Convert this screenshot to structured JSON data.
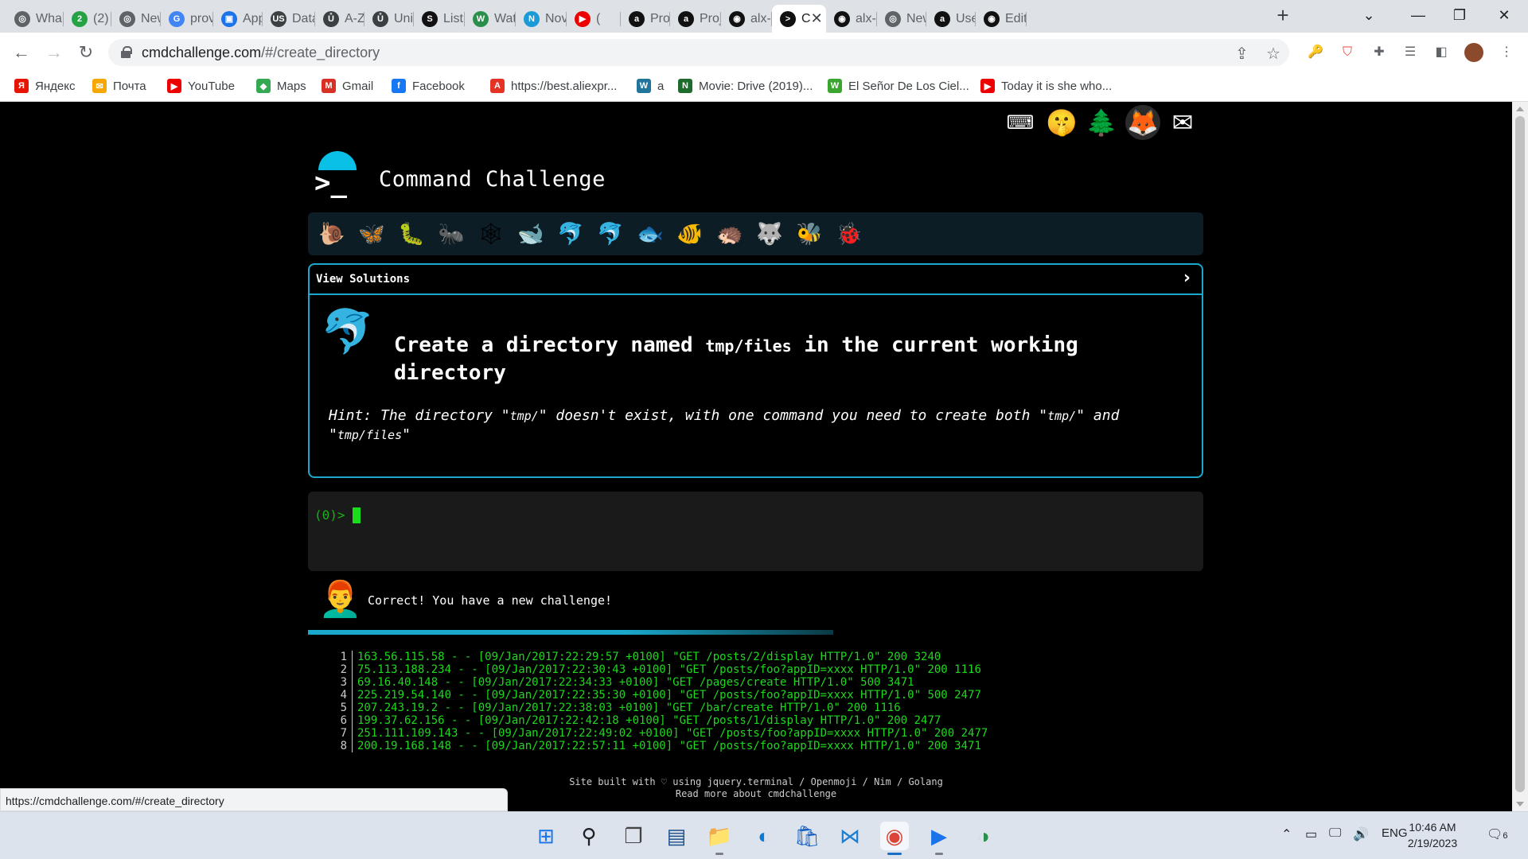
{
  "browser": {
    "tabs": [
      {
        "label": "Wha",
        "icon": "whatsapp-icon",
        "color": "#5f6368",
        "glyph": "◎"
      },
      {
        "label": "(2) V",
        "icon": "whatsapp-2-icon",
        "color": "#25a244",
        "glyph": "2"
      },
      {
        "label": "New",
        "icon": "chrome-icon",
        "color": "#5f6368",
        "glyph": "◎"
      },
      {
        "label": "prov",
        "icon": "google-icon",
        "color": "#4285f4",
        "glyph": "G"
      },
      {
        "label": "App",
        "icon": "app-icon",
        "color": "#1a73e8",
        "glyph": "▣"
      },
      {
        "label": "Data",
        "icon": "data-icon",
        "color": "#3c4043",
        "glyph": "US"
      },
      {
        "label": "A-Z",
        "icon": "az-icon",
        "color": "#3c4043",
        "glyph": "Ů"
      },
      {
        "label": "Univ",
        "icon": "univ-icon",
        "color": "#3c4043",
        "glyph": "Ů"
      },
      {
        "label": "List",
        "icon": "list-icon",
        "color": "#111",
        "glyph": "S"
      },
      {
        "label": "Wat",
        "icon": "wat-icon",
        "color": "#2a8f4a",
        "glyph": "W"
      },
      {
        "label": "Nov",
        "icon": "nov-icon",
        "color": "#1a9ad6",
        "glyph": "N"
      },
      {
        "label": "(",
        "icon": "youtube-icon",
        "color": "#e00",
        "glyph": "▶"
      },
      {
        "label": "Proj",
        "icon": "alx-icon",
        "color": "#111",
        "glyph": "a"
      },
      {
        "label": "Proj",
        "icon": "alx-icon",
        "color": "#111",
        "glyph": "a"
      },
      {
        "label": "alx-s",
        "icon": "github-icon",
        "color": "#111",
        "glyph": "◉"
      },
      {
        "label": "C",
        "icon": "terminal-icon",
        "color": "#111",
        "glyph": ">"
      },
      {
        "label": "alx-s",
        "icon": "github-icon",
        "color": "#111",
        "glyph": "◉"
      },
      {
        "label": "New",
        "icon": "chrome-icon",
        "color": "#5f6368",
        "glyph": "◎"
      },
      {
        "label": "User",
        "icon": "alx-icon",
        "color": "#111",
        "glyph": "a"
      },
      {
        "label": "Edit",
        "icon": "github-icon",
        "color": "#111",
        "glyph": "◉"
      }
    ],
    "url_host": "cmdchallenge.com",
    "url_path": "/#/create_directory",
    "bookmarks": [
      {
        "label": "Яндекс",
        "icon": "yandex-icon",
        "color": "#e61400",
        "glyph": "Я"
      },
      {
        "label": "Почта",
        "icon": "mail-icon",
        "color": "#f6a800",
        "glyph": "✉"
      },
      {
        "label": "YouTube",
        "icon": "youtube-icon",
        "color": "#e00",
        "glyph": "▶"
      },
      {
        "label": "Maps",
        "icon": "maps-icon",
        "color": "#34a853",
        "glyph": "◆"
      },
      {
        "label": "Gmail",
        "icon": "gmail-icon",
        "color": "#d93025",
        "glyph": "M"
      },
      {
        "label": "Facebook",
        "icon": "facebook-icon",
        "color": "#1877f2",
        "glyph": "f"
      },
      {
        "label": "https://best.aliexpr...",
        "icon": "aliexpress-icon",
        "color": "#e43225",
        "glyph": "A"
      },
      {
        "label": "a",
        "icon": "wordpress-icon",
        "color": "#21759b",
        "glyph": "W"
      },
      {
        "label": "Movie: Drive (2019)...",
        "icon": "n-icon",
        "color": "#1e6b2e",
        "glyph": "N"
      },
      {
        "label": "El Señor De Los Ciel...",
        "icon": "w-icon",
        "color": "#3aa62f",
        "glyph": "W"
      },
      {
        "label": "Today it is she who...",
        "icon": "youtube-icon",
        "color": "#e00",
        "glyph": "▶"
      }
    ],
    "status_url": "https://cmdchallenge.com/#/create_directory"
  },
  "page": {
    "top_icons": [
      "⌨",
      "🤫",
      "🌲",
      "🦊",
      "✉"
    ],
    "logo_glyph": ">_",
    "title": "Command Challenge",
    "levels": [
      "🐌",
      "🦋",
      "🐛",
      "🐜",
      "🕸",
      "🐋",
      "🐬",
      "🐬",
      "🐟",
      "🐠",
      "🦔",
      "🐺",
      "🐝",
      "🐞"
    ],
    "view_solutions": "View Solutions",
    "challenge_animal": "🐬",
    "challenge_pre": "Create a directory named ",
    "challenge_code": "tmp/files",
    "challenge_post": " in the current working directory",
    "hint_a": "Hint: The directory \"",
    "hint_code1": "tmp/",
    "hint_b": "\" doesn't exist, with one command you need to create both \"",
    "hint_code2": "tmp/",
    "hint_c": "\" and \"",
    "hint_code3": "tmp/files",
    "hint_d": "\"",
    "prompt": "(0)> ",
    "feedback": "Correct! You have a new challenge!",
    "feedback_avatar": "👨‍🦰",
    "file_lines": [
      "163.56.115.58 - - [09/Jan/2017:22:29:57 +0100] \"GET /posts/2/display HTTP/1.0\" 200 3240",
      "75.113.188.234 - - [09/Jan/2017:22:30:43 +0100] \"GET /posts/foo?appID=xxxx HTTP/1.0\" 200 1116",
      "69.16.40.148 - - [09/Jan/2017:22:34:33 +0100] \"GET /pages/create HTTP/1.0\" 500 3471",
      "225.219.54.140 - - [09/Jan/2017:22:35:30 +0100] \"GET /posts/foo?appID=xxxx HTTP/1.0\" 500 2477",
      "207.243.19.2 - - [09/Jan/2017:22:38:03 +0100] \"GET /bar/create HTTP/1.0\" 200 1116",
      "199.37.62.156 - - [09/Jan/2017:22:42:18 +0100] \"GET /posts/1/display HTTP/1.0\" 200 2477",
      "251.111.109.143 - - [09/Jan/2017:22:49:02 +0100] \"GET /posts/foo?appID=xxxx HTTP/1.0\" 200 2477",
      "200.19.168.148 - - [09/Jan/2017:22:57:11 +0100] \"GET /posts/foo?appID=xxxx HTTP/1.0\" 200 3471"
    ],
    "footer_line1": "Site built with ♡ using jquery.terminal / Openmoji / Nim / Golang",
    "footer_line2": "Read more about cmdchallenge",
    "accent": "#1aa9cc",
    "prompt_color": "#17b217"
  },
  "taskbar": {
    "language": "ENG",
    "time": "10:46 AM",
    "date": "2/19/2023",
    "notifications": "6"
  }
}
